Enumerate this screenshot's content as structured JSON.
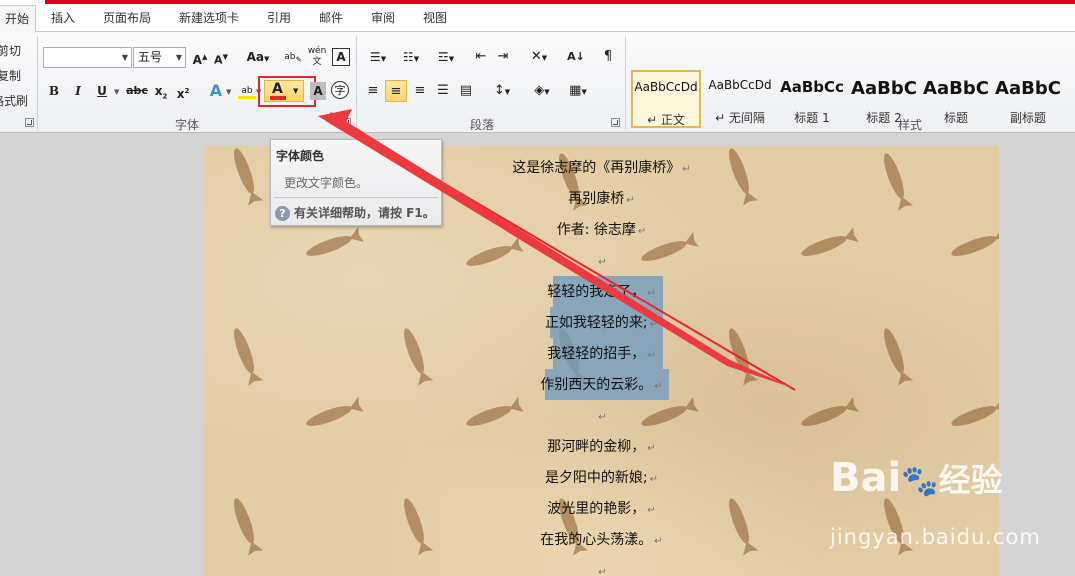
{
  "tabs": [
    {
      "label": "开始",
      "active": true
    },
    {
      "label": "插入"
    },
    {
      "label": "页面布局"
    },
    {
      "label": "新建选项卡"
    },
    {
      "label": "引用"
    },
    {
      "label": "邮件"
    },
    {
      "label": "审阅"
    },
    {
      "label": "视图"
    }
  ],
  "clipboard": {
    "cut": "剪切",
    "copy": "复制",
    "format_painter": "格式刷"
  },
  "font": {
    "font_name_value": "",
    "font_size_value": "五号",
    "group_label": "字体",
    "grow_icon": "A",
    "shrink_icon": "A",
    "change_case": "Aa",
    "bold": "B",
    "italic": "I",
    "underline": "U",
    "strike": "abc",
    "subscript": "x",
    "superscript": "x",
    "font_color_letter": "A",
    "char_shading": "A",
    "enclose_char": "字"
  },
  "paragraph": {
    "group_label": "段落"
  },
  "styles": {
    "group_label": "样式",
    "items": [
      {
        "sample": "AaBbCcDd",
        "name": "↵ 正文",
        "active": true
      },
      {
        "sample": "AaBbCcDd",
        "name": "↵ 无间隔"
      },
      {
        "sample": "AaBbCc",
        "name": "标题 1"
      },
      {
        "sample": "AaBbC",
        "name": "标题 2"
      },
      {
        "sample": "AaBbC",
        "name": "标题"
      },
      {
        "sample": "AaBbC",
        "name": "副标题"
      }
    ]
  },
  "tooltip": {
    "title": "字体颜色",
    "description": "更改文字颜色。",
    "help": "有关详细帮助，请按 F1。"
  },
  "document": {
    "lines": [
      "这是徐志摩的《再别康桥》",
      "再别康桥",
      "作者: 徐志摩",
      "",
      "轻轻的我走了，",
      "正如我轻轻的来;",
      "我轻轻的招手，",
      "作别西天的云彩。",
      "",
      "那河畔的金柳，",
      "是夕阳中的新娘;",
      "波光里的艳影，",
      "在我的心头荡漾。",
      ""
    ],
    "paragraph_mark": "↵"
  },
  "watermark": {
    "brand": "Bai",
    "brand_cn": "经验",
    "url": "jingyan.baidu.com"
  },
  "colors": {
    "accent_red": "#e0001b",
    "selection": "#709bc0",
    "font_color_bar": "#e8252a"
  }
}
